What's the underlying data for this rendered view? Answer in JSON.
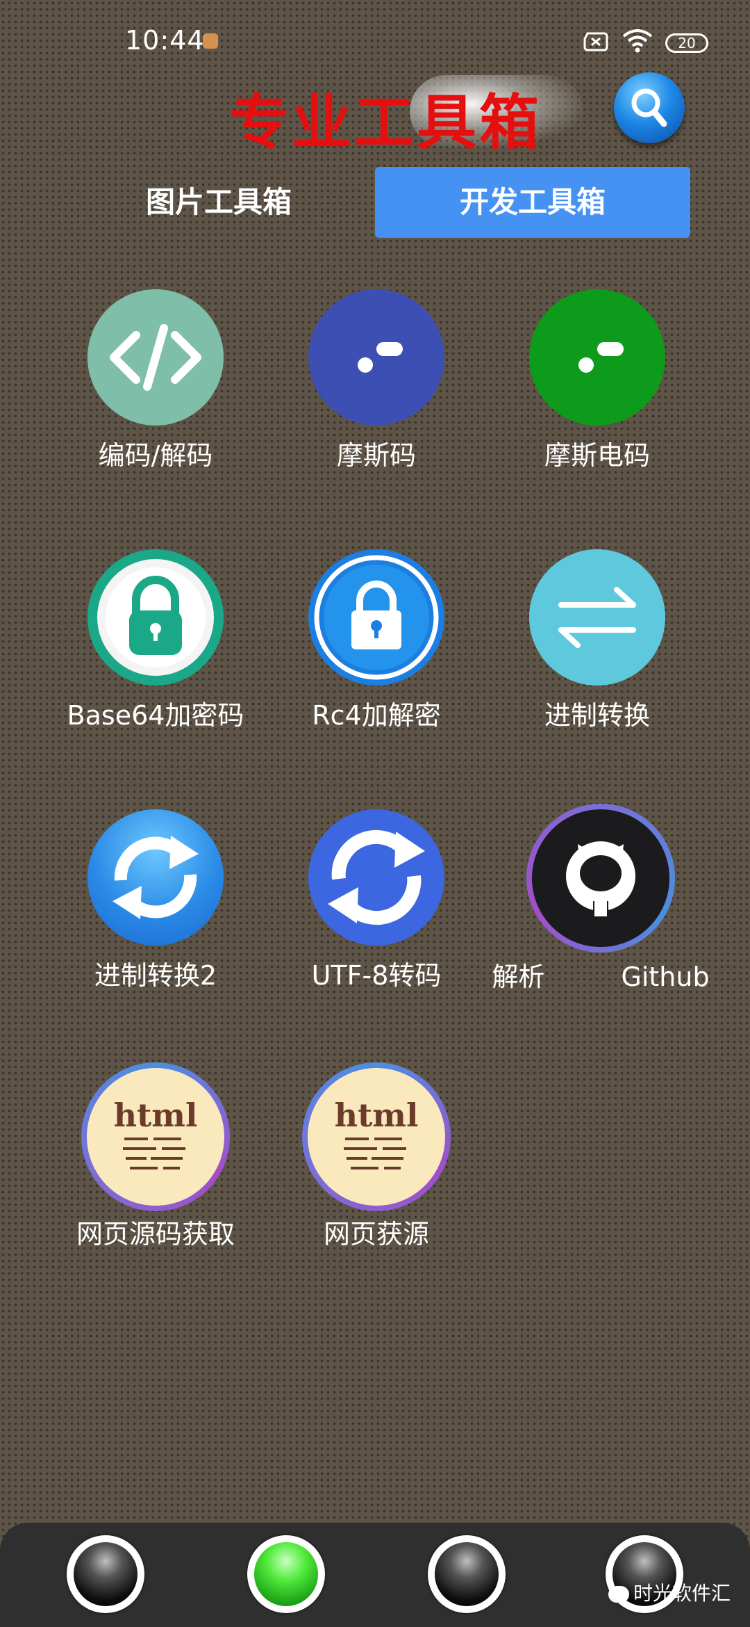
{
  "status_bar": {
    "time": "10:44",
    "battery": "20"
  },
  "header": {
    "title": "专业工具箱",
    "search_icon": "search-icon"
  },
  "tabs": [
    {
      "label": "图片工具箱",
      "active": false
    },
    {
      "label": "开发工具箱",
      "active": true
    }
  ],
  "tools": [
    {
      "label": "编码/解码",
      "icon": "code-icon",
      "color": "#7fbfa9"
    },
    {
      "label": "摩斯码",
      "icon": "morse-dots-icon",
      "color": "#3e4fb3"
    },
    {
      "label": "摩斯电码",
      "icon": "morse-dots-icon",
      "color": "#0e9a1a"
    },
    {
      "label": "Base64加密码",
      "icon": "padlock-icon",
      "color": "#1aa888"
    },
    {
      "label": "Rc4加解密",
      "icon": "padlock-icon",
      "color": "#1c7ee0"
    },
    {
      "label": "进制转换",
      "icon": "swap-arrows-icon",
      "color": "#5ec9dd"
    },
    {
      "label": "进制转换2",
      "icon": "sync-arrows-icon",
      "color": "#2a8ae6"
    },
    {
      "label": "UTF-8转码",
      "icon": "sync-arrows-icon",
      "color": "#3c67e0"
    },
    {
      "label": "解析",
      "label2": "Github",
      "icon": "github-icon",
      "color": "#1b1b1d"
    },
    {
      "label": "网页源码获取",
      "icon": "html-paper-icon",
      "color": "#fbe9be"
    },
    {
      "label": "网页获源",
      "icon": "html-paper-icon",
      "color": "#fbe9be"
    }
  ],
  "bottom_nav": [
    {
      "name": "nav-orb-1",
      "active": false
    },
    {
      "name": "nav-orb-2",
      "active": true
    },
    {
      "name": "nav-orb-3",
      "active": false
    },
    {
      "name": "nav-orb-4",
      "active": false
    }
  ],
  "watermark": "时光软件汇"
}
